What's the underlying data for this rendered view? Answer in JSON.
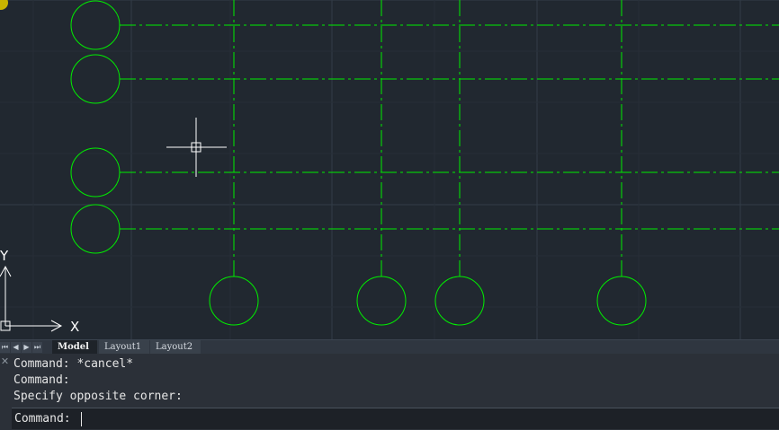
{
  "tabs": {
    "nav": [
      "first-tab",
      "previous-tab",
      "next-tab",
      "last-tab"
    ],
    "items": [
      {
        "label": "Model",
        "active": true
      },
      {
        "label": "Layout1",
        "active": false
      },
      {
        "label": "Layout2",
        "active": false
      }
    ]
  },
  "ucs": {
    "x_label": "X",
    "y_label": "Y"
  },
  "command": {
    "history": [
      "Command: *cancel*",
      "Command:",
      "Specify opposite corner:"
    ],
    "prompt": "Command:",
    "input_value": ""
  },
  "colors": {
    "background": "#212830",
    "grid": "#333c47",
    "entities": "#00ee00",
    "crosshair": "#ffffff"
  }
}
